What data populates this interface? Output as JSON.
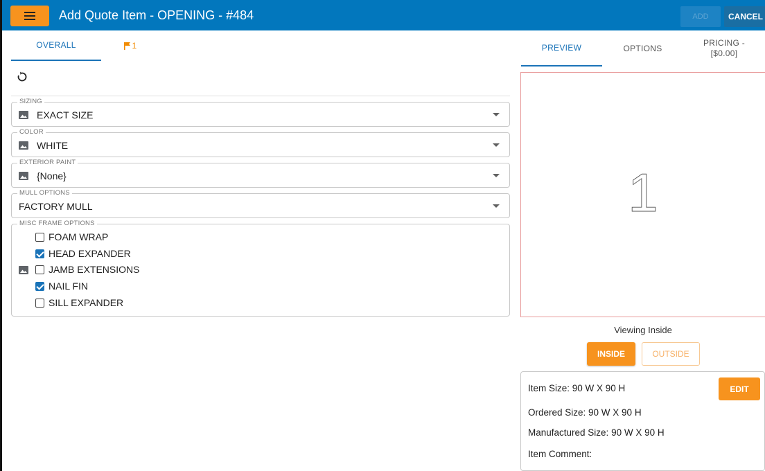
{
  "header": {
    "title": "Add Quote Item - OPENING - #484",
    "add_label": "ADD",
    "cancel_label": "CANCEL",
    "bar_color": "#0277bd",
    "accent_color": "#f7931e"
  },
  "left_tabs": [
    {
      "label": "OVERALL",
      "active": true
    },
    {
      "label": "1",
      "icon": "flag-icon"
    }
  ],
  "form": {
    "sizing": {
      "legend": "SIZING",
      "value": "EXACT SIZE"
    },
    "color": {
      "legend": "COLOR",
      "value": "WHITE"
    },
    "exterior_paint": {
      "legend": "EXTERIOR PAINT",
      "value": "{None}"
    },
    "mull_options": {
      "legend": "MULL OPTIONS",
      "value": "FACTORY MULL"
    },
    "misc_frame": {
      "legend": "MISC FRAME OPTIONS",
      "options": [
        {
          "label": "FOAM WRAP",
          "checked": false
        },
        {
          "label": "HEAD EXPANDER",
          "checked": true
        },
        {
          "label": "JAMB EXTENSIONS",
          "checked": false
        },
        {
          "label": "NAIL FIN",
          "checked": true
        },
        {
          "label": "SILL EXPANDER",
          "checked": false
        }
      ]
    }
  },
  "right_tabs": {
    "preview": "PREVIEW",
    "options": "OPTIONS",
    "pricing_line1": "PRICING -",
    "pricing_line2": "[$0.00]"
  },
  "preview": {
    "number": "1",
    "viewing_text": "Viewing Inside",
    "inside_label": "INSIDE",
    "outside_label": "OUTSIDE"
  },
  "info": {
    "item_size": "Item Size:  90 W X 90 H",
    "ordered_size": "Ordered Size:  90 W X 90 H",
    "manufactured_size": "Manufactured Size:  90 W X 90 H",
    "item_comment": "Item Comment:",
    "edit_label": "EDIT"
  }
}
